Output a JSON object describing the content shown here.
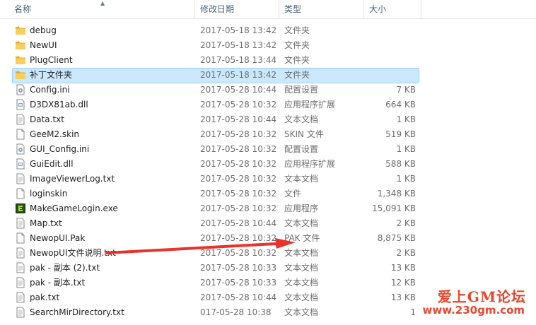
{
  "header": {
    "name": "名称",
    "modified": "修改日期",
    "type": "类型",
    "size": "大小"
  },
  "files": [
    {
      "name": "debug",
      "date": "2017-05-18 13:42",
      "type": "文件夹",
      "size": "",
      "icon": "folder-icon"
    },
    {
      "name": "NewUI",
      "date": "2017-05-18 13:42",
      "type": "文件夹",
      "size": "",
      "icon": "folder-icon"
    },
    {
      "name": "PlugClient",
      "date": "2017-05-18 13:44",
      "type": "文件夹",
      "size": "",
      "icon": "folder-icon"
    },
    {
      "name": "补丁文件夹",
      "date": "2017-05-18 13:42",
      "type": "文件夹",
      "size": "",
      "icon": "folder-icon",
      "selected": true
    },
    {
      "name": "Config.ini",
      "date": "2017-05-28 10:44",
      "type": "配置设置",
      "size": "7 KB",
      "icon": "settings-file-icon"
    },
    {
      "name": "D3DX81ab.dll",
      "date": "2017-05-28 10:32",
      "type": "应用程序扩展",
      "size": "664 KB",
      "icon": "dll-file-icon"
    },
    {
      "name": "Data.txt",
      "date": "2017-05-28 10:44",
      "type": "文本文档",
      "size": "1 KB",
      "icon": "text-file-icon"
    },
    {
      "name": "GeeM2.skin",
      "date": "2017-05-28 10:32",
      "type": "SKIN 文件",
      "size": "519 KB",
      "icon": "blank-file-icon"
    },
    {
      "name": "GUI_Config.ini",
      "date": "2017-05-28 10:32",
      "type": "配置设置",
      "size": "1 KB",
      "icon": "settings-file-icon"
    },
    {
      "name": "GuiEdit.dll",
      "date": "2017-05-28 10:32",
      "type": "应用程序扩展",
      "size": "588 KB",
      "icon": "dll-file-icon"
    },
    {
      "name": "ImageViewerLog.txt",
      "date": "2017-05-28 10:32",
      "type": "文本文档",
      "size": "1 KB",
      "icon": "text-file-icon"
    },
    {
      "name": "loginskin",
      "date": "2017-05-28 10:32",
      "type": "文件",
      "size": "1,348 KB",
      "icon": "blank-file-icon"
    },
    {
      "name": "MakeGameLogin.exe",
      "date": "2017-05-28 10:32",
      "type": "应用程序",
      "size": "15,091 KB",
      "icon": "exe-app-icon"
    },
    {
      "name": "Map.txt",
      "date": "2017-05-28 10:44",
      "type": "文本文档",
      "size": "2 KB",
      "icon": "text-file-icon"
    },
    {
      "name": "NewopUI.Pak",
      "date": "2017-05-28 10:32",
      "type": "PAK 文件",
      "size": "8,875 KB",
      "icon": "blank-file-icon"
    },
    {
      "name": "NewopUI文件说明.txt",
      "date": "2017-05-28 10:32",
      "type": "文本文档",
      "size": "2 KB",
      "icon": "text-file-icon"
    },
    {
      "name": "pak - 副本 (2).txt",
      "date": "2017-05-28 10:33",
      "type": "文本文档",
      "size": "13 KB",
      "icon": "text-file-icon"
    },
    {
      "name": "pak - 副本.txt",
      "date": "2017-05-28 10:33",
      "type": "文本文档",
      "size": "12 KB",
      "icon": "text-file-icon"
    },
    {
      "name": "pak.txt",
      "date": "2017-05-28 10:44",
      "type": "文本文档",
      "size": "13 KB",
      "icon": "text-file-icon"
    },
    {
      "name": "SearchMirDirectory.txt",
      "date": "017-05-28 10:38",
      "type": "文本文档",
      "size": "1",
      "icon": "text-file-icon"
    }
  ],
  "watermark": {
    "line1": "爱上GM论坛",
    "line2": "www.230gm.com"
  },
  "colors": {
    "selection": "#cce8ff",
    "arrow": "#e8322a",
    "folder": "#f3c24f"
  }
}
